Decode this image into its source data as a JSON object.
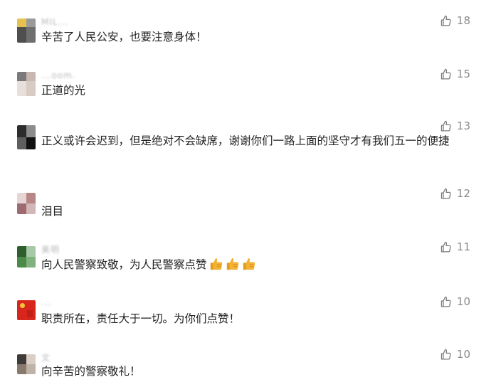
{
  "comments": [
    {
      "name": "MIL...",
      "text": "辛苦了人民公安，也要注意身体！",
      "likes": "18",
      "avatar_colors": [
        "#e5c24d",
        "#6f6f6f",
        "#9a9a9a",
        "#4f4f4f"
      ]
    },
    {
      "name": "...oom.",
      "text": "正道的光",
      "likes": "15",
      "avatar_colors": [
        "#7a7a7a",
        "#c9b7b2",
        "#d8cbc4",
        "#e8dfdb"
      ]
    },
    {
      "name": "",
      "text": "正义或许会迟到，但是绝对不会缺席，谢谢你们一路上面的坚守才有我们五一的便捷",
      "likes": "13",
      "avatar_colors": [
        "#2d2d2d",
        "#5e5e5e",
        "#111111",
        "#8c8c8c"
      ]
    },
    {
      "name": "",
      "text": "泪目",
      "likes": "12",
      "avatar_colors": [
        "#d3b6b6",
        "#9c6a6f",
        "#b98686",
        "#e7d5d5"
      ]
    },
    {
      "name": "美明",
      "text": "向人民警察致敬，为人民警察点赞",
      "likes": "11",
      "avatar_colors": [
        "#4c8a4a",
        "#7fb27d",
        "#2e5e2d",
        "#a8c9a6"
      ],
      "emoji_count": 3
    },
    {
      "name": "...",
      "text": "职责所在，责任大于一切。为你们点赞！",
      "likes": "10",
      "avatar_colors": [
        "#d9261c",
        "#f2c53b",
        "#c01f17",
        "#e85d3a"
      ]
    },
    {
      "name": "文",
      "text": "向辛苦的警察敬礼！",
      "likes": "10",
      "avatar_colors": [
        "#8a7a6e",
        "#3e3a37",
        "#bfb3a8",
        "#d9cfc6"
      ]
    }
  ],
  "colors": {
    "text": "#222222",
    "likes": "#8a8a8a",
    "thumb_emoji": "#f2b233"
  },
  "icons": {
    "like": "thumbs-up-outline-icon",
    "emoji": "thumbs-up-emoji-icon"
  }
}
